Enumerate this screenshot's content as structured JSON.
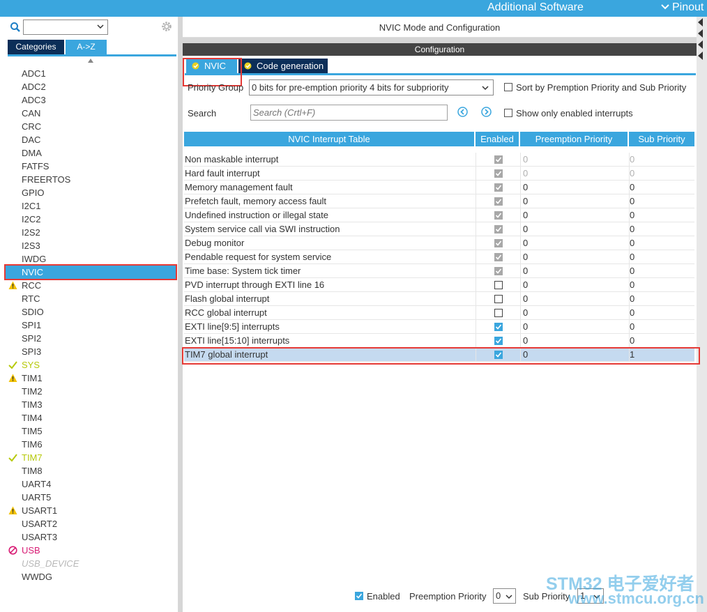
{
  "topbar": {
    "additional_software": "Additional Software",
    "pinout": "Pinout"
  },
  "left": {
    "tab_categories": "Categories",
    "tab_az": "A->Z",
    "peripherals": [
      {
        "label": "ADC1",
        "status": "none"
      },
      {
        "label": "ADC2",
        "status": "none"
      },
      {
        "label": "ADC3",
        "status": "none"
      },
      {
        "label": "CAN",
        "status": "none"
      },
      {
        "label": "CRC",
        "status": "none"
      },
      {
        "label": "DAC",
        "status": "none"
      },
      {
        "label": "DMA",
        "status": "none"
      },
      {
        "label": "FATFS",
        "status": "none"
      },
      {
        "label": "FREERTOS",
        "status": "none"
      },
      {
        "label": "GPIO",
        "status": "none"
      },
      {
        "label": "I2C1",
        "status": "none"
      },
      {
        "label": "I2C2",
        "status": "none"
      },
      {
        "label": "I2S2",
        "status": "none"
      },
      {
        "label": "I2S3",
        "status": "none"
      },
      {
        "label": "IWDG",
        "status": "none"
      },
      {
        "label": "NVIC",
        "status": "selected"
      },
      {
        "label": "RCC",
        "status": "warning"
      },
      {
        "label": "RTC",
        "status": "none"
      },
      {
        "label": "SDIO",
        "status": "none"
      },
      {
        "label": "SPI1",
        "status": "none"
      },
      {
        "label": "SPI2",
        "status": "none"
      },
      {
        "label": "SPI3",
        "status": "none"
      },
      {
        "label": "SYS",
        "status": "ok"
      },
      {
        "label": "TIM1",
        "status": "warning"
      },
      {
        "label": "TIM2",
        "status": "none"
      },
      {
        "label": "TIM3",
        "status": "none"
      },
      {
        "label": "TIM4",
        "status": "none"
      },
      {
        "label": "TIM5",
        "status": "none"
      },
      {
        "label": "TIM6",
        "status": "none"
      },
      {
        "label": "TIM7",
        "status": "ok"
      },
      {
        "label": "TIM8",
        "status": "none"
      },
      {
        "label": "UART4",
        "status": "none"
      },
      {
        "label": "UART5",
        "status": "none"
      },
      {
        "label": "USART1",
        "status": "warning"
      },
      {
        "label": "USART2",
        "status": "none"
      },
      {
        "label": "USART3",
        "status": "none"
      },
      {
        "label": "USB",
        "status": "disabled"
      },
      {
        "label": "USB_DEVICE",
        "status": "unavailable"
      },
      {
        "label": "WWDG",
        "status": "none"
      }
    ]
  },
  "main": {
    "mode_title": "NVIC Mode and Configuration",
    "config_title": "Configuration",
    "tab_nvic": "NVIC",
    "tab_code": "Code generation",
    "priority_group_label": "Priority Group",
    "priority_group_value": "0 bits for pre-emption priority 4 bits for subpriority",
    "sort_label": "Sort by Premption Priority and Sub Priority",
    "search_label": "Search",
    "search_placeholder": "Search (Crtl+F)",
    "show_enabled_label": "Show only enabled interrupts",
    "table": {
      "headers": [
        "NVIC Interrupt Table",
        "Enabled",
        "Preemption Priority",
        "Sub Priority"
      ],
      "rows": [
        {
          "name": "Non maskable interrupt",
          "enabled": "locked",
          "pp": "0",
          "sp": "0",
          "dim": true
        },
        {
          "name": "Hard fault interrupt",
          "enabled": "locked",
          "pp": "0",
          "sp": "0",
          "dim": true
        },
        {
          "name": "Memory management fault",
          "enabled": "locked",
          "pp": "0",
          "sp": "0",
          "dim": false
        },
        {
          "name": "Prefetch fault, memory access fault",
          "enabled": "locked",
          "pp": "0",
          "sp": "0",
          "dim": false
        },
        {
          "name": "Undefined instruction or illegal state",
          "enabled": "locked",
          "pp": "0",
          "sp": "0",
          "dim": false
        },
        {
          "name": "System service call via SWI instruction",
          "enabled": "locked",
          "pp": "0",
          "sp": "0",
          "dim": false
        },
        {
          "name": "Debug monitor",
          "enabled": "locked",
          "pp": "0",
          "sp": "0",
          "dim": false
        },
        {
          "name": "Pendable request for system service",
          "enabled": "locked",
          "pp": "0",
          "sp": "0",
          "dim": false
        },
        {
          "name": "Time base: System tick timer",
          "enabled": "locked",
          "pp": "0",
          "sp": "0",
          "dim": false
        },
        {
          "name": "PVD interrupt through EXTI line 16",
          "enabled": "off",
          "pp": "0",
          "sp": "0",
          "dim": false
        },
        {
          "name": "Flash global interrupt",
          "enabled": "off",
          "pp": "0",
          "sp": "0",
          "dim": false
        },
        {
          "name": "RCC global interrupt",
          "enabled": "off",
          "pp": "0",
          "sp": "0",
          "dim": false
        },
        {
          "name": "EXTI line[9:5] interrupts",
          "enabled": "on",
          "pp": "0",
          "sp": "0",
          "dim": false
        },
        {
          "name": "EXTI line[15:10] interrupts",
          "enabled": "on",
          "pp": "0",
          "sp": "0",
          "dim": false
        },
        {
          "name": "TIM7 global interrupt",
          "enabled": "on",
          "pp": "0",
          "sp": "1",
          "dim": false,
          "selected": true
        }
      ]
    }
  },
  "bottom": {
    "enabled_label": "Enabled",
    "preemption_label": "Preemption Priority",
    "preemption_value": "0",
    "sub_label": "Sub Priority",
    "sub_value": "1"
  },
  "watermark": {
    "line1": "STM32 电子爱好者",
    "line2": "www.stmcu.org.cn"
  },
  "colors": {
    "accent": "#3aa6de",
    "navy": "#0b2e58",
    "highlight_red": "#e53935",
    "ok_green": "#b6c90a",
    "warning_yellow": "#f2c200",
    "usb_pink": "#d81b74"
  }
}
